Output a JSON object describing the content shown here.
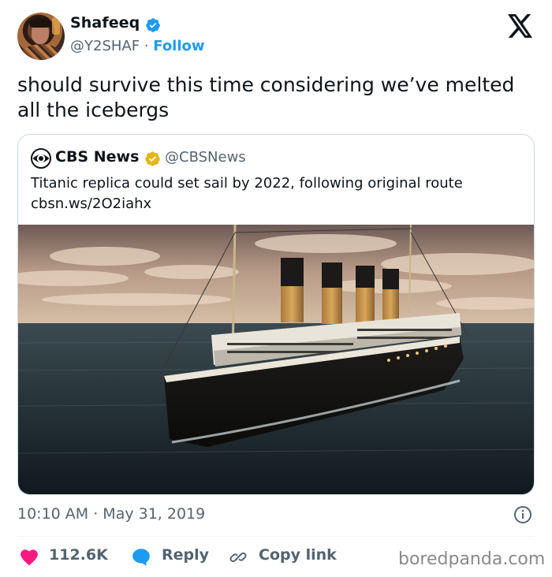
{
  "author": {
    "name": "Shafeeq",
    "handle": "@Y2SHAF",
    "separator": " · ",
    "follow_label": "Follow"
  },
  "tweet": {
    "text": "should survive this time considering we’ve melted all the icebergs"
  },
  "quoted": {
    "name": "CBS News",
    "handle": "@CBSNews",
    "text_line1": "Titanic replica could set sail by 2022, following original route",
    "text_line2": "cbsn.ws/2O2iahx"
  },
  "meta": {
    "timestamp": "10:10 AM · May 31, 2019"
  },
  "actions": {
    "likes": "112.6K",
    "reply_label": "Reply",
    "copy_link_label": "Copy link"
  },
  "watermark": "boredpanda.com",
  "colors": {
    "accent": "#1d9bf0",
    "like": "#f91880",
    "secondary_text": "#536471",
    "gold_badge": "#e2b719"
  },
  "icons": [
    "verified-badge-icon",
    "x-logo-icon",
    "cbs-eye-icon",
    "gold-verified-icon",
    "info-icon",
    "heart-icon",
    "reply-bubble-icon",
    "link-icon"
  ]
}
